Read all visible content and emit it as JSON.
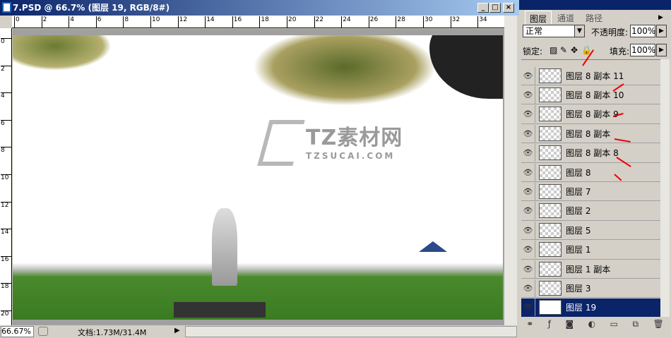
{
  "document": {
    "title": "7.PSD @ 66.7% (图层 19, RGB/8#)",
    "zoom": "66.67%",
    "doc_info": "文档:1.73M/31.4M",
    "h_ruler": [
      "0",
      "2",
      "4",
      "6",
      "8",
      "10",
      "12",
      "14",
      "16",
      "18",
      "20",
      "22",
      "24",
      "26",
      "28",
      "30",
      "32",
      "34"
    ],
    "v_ruler": [
      "0",
      "2",
      "4",
      "6",
      "8",
      "10",
      "12",
      "14",
      "16",
      "18",
      "20"
    ],
    "watermark": {
      "main": "TZ素材网",
      "sub": "TZSUCAI.COM"
    }
  },
  "panel": {
    "tabs": [
      "图层",
      "通道",
      "路径"
    ],
    "blend_mode": "正常",
    "opacity_label": "不透明度:",
    "opacity": "100%",
    "lock_label": "锁定:",
    "fill_label": "填充:",
    "fill": "100%",
    "layers": [
      "图层 8 副本 11",
      "图层 8 副本 10",
      "图层 8 副本 9",
      "图层 8 副本",
      "图层 8 副本 8",
      "图层 8",
      "图层 7",
      "图层 2",
      "图层 5",
      "图层 1",
      "图层 1 副本",
      "图层 3",
      "图层 19"
    ],
    "selected_layer": "图层 19"
  },
  "colors": {
    "title_bar": "#0a246a",
    "selection": "#0a246a",
    "annotation_arrow": "#e00000"
  }
}
